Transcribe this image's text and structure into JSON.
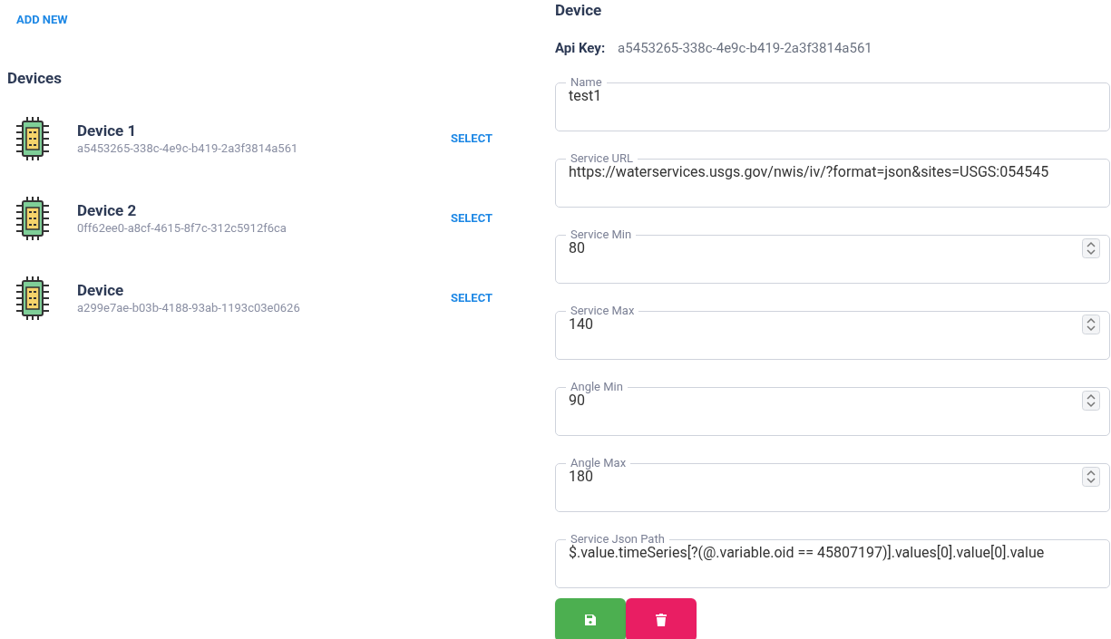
{
  "add_new": "ADD NEW",
  "devices_title": "Devices",
  "devices": [
    {
      "name": "Device 1",
      "key": "a5453265-338c-4e9c-b419-2a3f3814a561",
      "action": "SELECT"
    },
    {
      "name": "Device 2",
      "key": "0ff62ee0-a8cf-4615-8f7c-312c5912f6ca",
      "action": "SELECT"
    },
    {
      "name": "Device",
      "key": "a299e7ae-b03b-4188-93ab-1193c03e0626",
      "action": "SELECT"
    }
  ],
  "detail": {
    "title": "Device",
    "api_key_label": "Api Key:",
    "api_key": "a5453265-338c-4e9c-b419-2a3f3814a561",
    "fields": [
      {
        "label": "Name",
        "value": "test1",
        "kind": "text"
      },
      {
        "label": "Service URL",
        "value": "https://waterservices.usgs.gov/nwis/iv/?format=json&sites=USGS:054545",
        "kind": "text"
      },
      {
        "label": "Service Min",
        "value": "80",
        "kind": "number"
      },
      {
        "label": "Service Max",
        "value": "140",
        "kind": "number"
      },
      {
        "label": "Angle Min",
        "value": "90",
        "kind": "number"
      },
      {
        "label": "Angle Max",
        "value": "180",
        "kind": "number"
      },
      {
        "label": "Service Json Path",
        "value": "$.value.timeSeries[?(@.variable.oid == 45807197)].values[0].value[0].value",
        "kind": "text"
      }
    ]
  }
}
